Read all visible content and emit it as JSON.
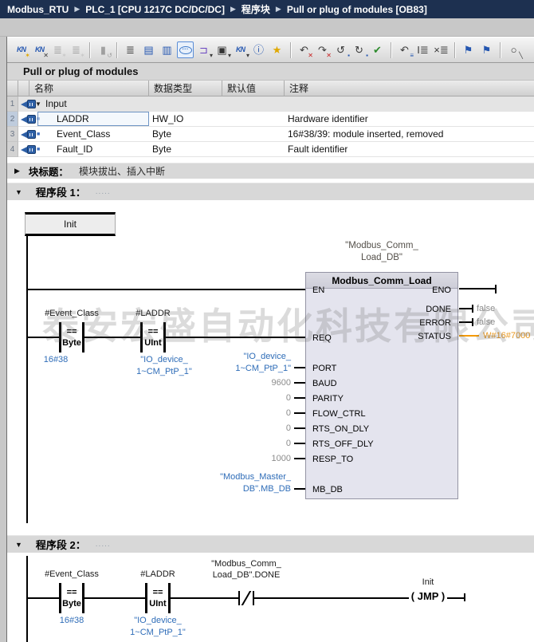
{
  "breadcrumb": {
    "separator": "▶",
    "items": [
      "Modbus_RTU",
      "PLC_1 [CPU 1217C DC/DC/DC]",
      "程序块",
      "Pull or plug of modules [OB83]"
    ]
  },
  "ui": {
    "tri_down": "▼",
    "tri_right": "▶",
    "bullet": "■"
  },
  "toolbar": {
    "icons": [
      {
        "name": "insert-network",
        "base": "KN",
        "badge": "✶"
      },
      {
        "name": "delete-network",
        "base": "KN",
        "badge": "✕"
      },
      {
        "name": "insert-row",
        "base": "≣",
        "badge": "✶"
      },
      {
        "name": "insert-row-after",
        "base": "≣",
        "badge": "✶"
      },
      {
        "name": "paste",
        "base": "▮",
        "badge": "↺"
      },
      {
        "name": "network-overview",
        "base": "≣",
        "badge": ""
      },
      {
        "name": "interface-top",
        "base": "▤",
        "badge": ""
      },
      {
        "name": "interface",
        "base": "▥",
        "badge": ""
      },
      {
        "name": "comments",
        "base": "···",
        "badge": ""
      },
      {
        "name": "expand-instructions",
        "base": "⊐",
        "badge": "▾"
      },
      {
        "name": "free-comment",
        "base": "▣",
        "badge": "▾"
      },
      {
        "name": "expand-networks",
        "base": "KN",
        "badge": "▾"
      },
      {
        "name": "block-info",
        "base": "ⓘ",
        "badge": ""
      },
      {
        "name": "favorites",
        "base": "★",
        "badge": ""
      },
      {
        "name": "undo",
        "base": "↶",
        "badge": "✕"
      },
      {
        "name": "redo",
        "base": "↷",
        "badge": "✕"
      },
      {
        "name": "snapshot",
        "base": "↺",
        "badge": "▪"
      },
      {
        "name": "load-values",
        "base": "↻",
        "badge": "▪"
      },
      {
        "name": "compile",
        "base": "✔",
        "badge": ""
      },
      {
        "name": "monitor",
        "base": "↶",
        "badge": "≡"
      },
      {
        "name": "insert-io",
        "base": "I≣",
        "badge": ""
      },
      {
        "name": "reset-io",
        "base": "×≣",
        "badge": ""
      },
      {
        "name": "prev-bookmark",
        "base": "⚑",
        "badge": ""
      },
      {
        "name": "next-bookmark",
        "base": "⚑",
        "badge": ""
      },
      {
        "name": "find-replace",
        "base": "○",
        "badge": "╲"
      }
    ]
  },
  "interface_table": {
    "title": "Pull or plug of modules",
    "columns": [
      "名称",
      "数据类型",
      "默认值",
      "注释"
    ],
    "rows": [
      {
        "num": "1",
        "name": "Input",
        "type": "",
        "default": "",
        "comment": ""
      },
      {
        "num": "2",
        "name": "LADDR",
        "type": "HW_IO",
        "default": "",
        "comment": "Hardware identifier"
      },
      {
        "num": "3",
        "name": "Event_Class",
        "type": "Byte",
        "default": "",
        "comment": "16#38/39: module inserted, removed"
      },
      {
        "num": "4",
        "name": "Fault_ID",
        "type": "Byte",
        "default": "",
        "comment": "Fault identifier"
      }
    ]
  },
  "block_title_row": {
    "label": "块标题：",
    "value": "模块拔出、插入中断"
  },
  "networks": [
    {
      "label": "程序段 1：",
      "dots": "....."
    },
    {
      "label": "程序段 2：",
      "dots": "....."
    }
  ],
  "watermark": "泰安宏盛自动化科技有限公司",
  "network1": {
    "jump_label": "Init",
    "contacts": [
      {
        "tag": "#Event_Class",
        "op": "==",
        "type": "Byte",
        "operand": "16#38"
      },
      {
        "tag": "#LADDR",
        "op": "==",
        "type": "UInt",
        "operand_lines": [
          "\"IO_device_",
          "1~CM_PtP_1\""
        ]
      }
    ],
    "block": {
      "instance_lines": [
        "\"Modbus_Comm_",
        "Load_DB\""
      ],
      "title": "Modbus_Comm_Load",
      "left_pins": [
        {
          "name": "EN"
        },
        {
          "name": "REQ"
        },
        {
          "name": "PORT",
          "value_lines": [
            "\"IO_device_",
            "1~CM_PtP_1\""
          ]
        },
        {
          "name": "BAUD",
          "value": "9600"
        },
        {
          "name": "PARITY",
          "value": "0"
        },
        {
          "name": "FLOW_CTRL",
          "value": "0"
        },
        {
          "name": "RTS_ON_DLY",
          "value": "0"
        },
        {
          "name": "RTS_OFF_DLY",
          "value": "0"
        },
        {
          "name": "RESP_TO",
          "value": "1000"
        },
        {
          "name": "MB_DB",
          "value_lines": [
            "\"Modbus_Master_",
            "DB\".MB_DB"
          ]
        }
      ],
      "right_pins": [
        {
          "name": "ENO",
          "value": ""
        },
        {
          "name": "DONE",
          "value": "false"
        },
        {
          "name": "ERROR",
          "value": "false"
        },
        {
          "name": "STATUS",
          "value": "W#16#7000"
        }
      ]
    }
  },
  "network2": {
    "contacts": [
      {
        "tag": "#Event_Class",
        "op": "==",
        "type": "Byte",
        "operand": "16#38"
      },
      {
        "tag": "#LADDR",
        "op": "==",
        "type": "UInt",
        "operand_lines": [
          "\"IO_device_",
          "1~CM_PtP_1\""
        ]
      }
    ],
    "nc_contact": {
      "label_lines": [
        "\"Modbus_Comm_",
        "Load_DB\".DONE"
      ]
    },
    "coil": {
      "label": "Init",
      "op": "( JMP )"
    }
  }
}
